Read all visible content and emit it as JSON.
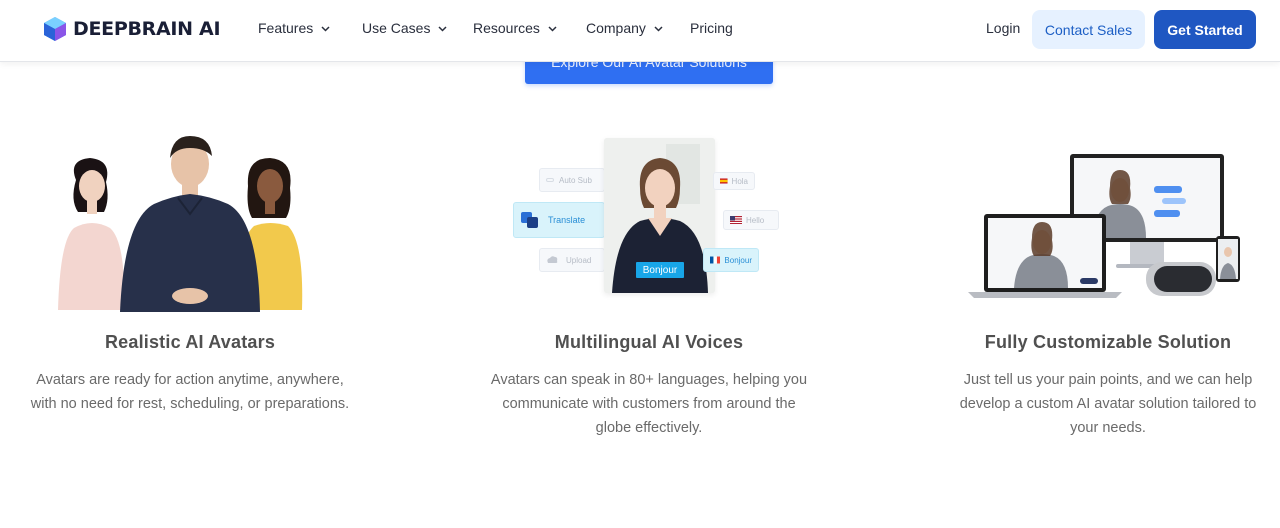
{
  "brand": {
    "name": "DEEPBRAIN AI"
  },
  "nav": [
    {
      "label": "Features",
      "has_dropdown": true
    },
    {
      "label": "Use Cases",
      "has_dropdown": true
    },
    {
      "label": "Resources",
      "has_dropdown": true
    },
    {
      "label": "Company",
      "has_dropdown": true
    },
    {
      "label": "Pricing",
      "has_dropdown": false
    }
  ],
  "header_actions": {
    "login": "Login",
    "contact_sales": "Contact Sales",
    "get_started": "Get Started"
  },
  "hero_cta": {
    "label": "Explore Our AI Avatar Solutions"
  },
  "features": [
    {
      "title": "Realistic AI Avatars",
      "description": "Avatars are ready for action anytime, anywhere, with no need for rest, scheduling, or preparations."
    },
    {
      "title": "Multilingual AI Voices",
      "description": "Avatars can speak in 80+ languages, helping you communicate with customers from around the globe effectively.",
      "illustration": {
        "chips": [
          "Auto",
          "Auto Sub",
          "Translate",
          "Upload",
          "Hola",
          "Hello",
          "Bonjour"
        ],
        "caption": "Bonjour"
      }
    },
    {
      "title": "Fully Customizable Solution",
      "description": "Just tell us your pain points, and we can help develop a custom AI avatar solution tailored to your needs."
    }
  ],
  "colors": {
    "primary": "#1f57c2",
    "contact_bg": "#e6f1ff",
    "cta": "#2f6ff2",
    "heading": "#505050",
    "body_text": "#6a6a6a"
  }
}
